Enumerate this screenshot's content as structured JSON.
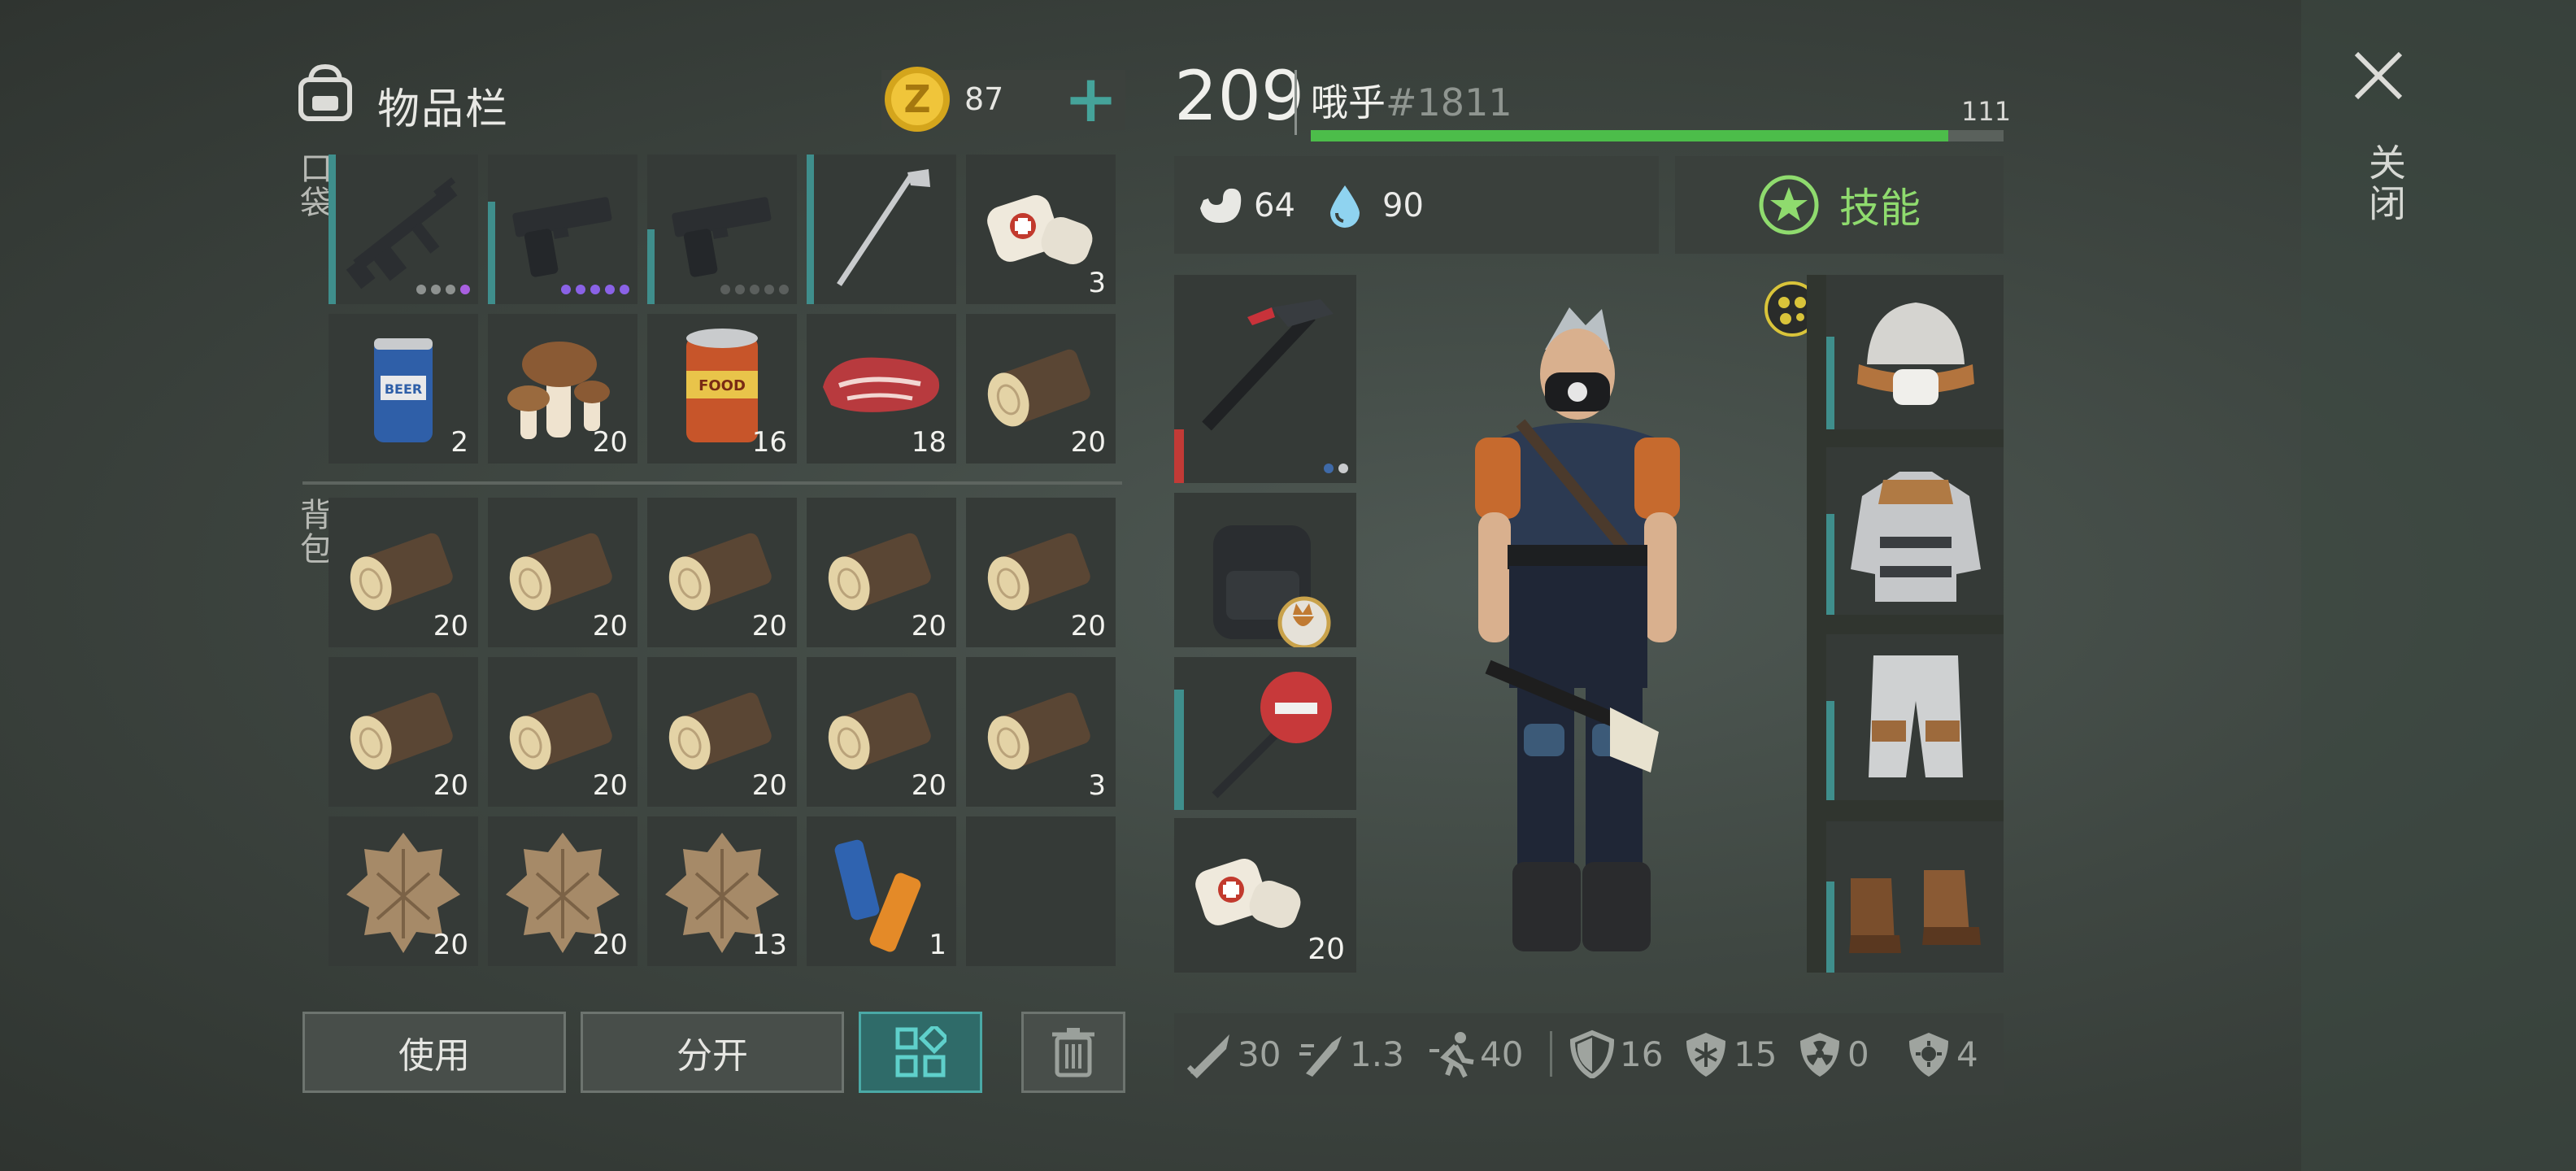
{
  "inventory": {
    "title": "物品栏",
    "coins": "87",
    "add_label": "+",
    "pocket_label": "口袋",
    "backpack_label": "背包",
    "pocket_slots": [
      {
        "item": "assault-rifle",
        "qty": ""
      },
      {
        "item": "pistol",
        "qty": ""
      },
      {
        "item": "pistol",
        "qty": ""
      },
      {
        "item": "golf-club",
        "qty": ""
      },
      {
        "item": "bandage",
        "qty": "3"
      },
      {
        "item": "beer-can",
        "qty": "2"
      },
      {
        "item": "mushrooms",
        "qty": "20"
      },
      {
        "item": "canned-food",
        "qty": "16"
      },
      {
        "item": "raw-steak",
        "qty": "18"
      },
      {
        "item": "wood-log",
        "qty": "20"
      }
    ],
    "backpack_slots": [
      {
        "item": "wood-log",
        "qty": "20"
      },
      {
        "item": "wood-log",
        "qty": "20"
      },
      {
        "item": "wood-log",
        "qty": "20"
      },
      {
        "item": "wood-log",
        "qty": "20"
      },
      {
        "item": "wood-log",
        "qty": "20"
      },
      {
        "item": "wood-log",
        "qty": "20"
      },
      {
        "item": "wood-log",
        "qty": "20"
      },
      {
        "item": "wood-log",
        "qty": "20"
      },
      {
        "item": "wood-log",
        "qty": "20"
      },
      {
        "item": "wood-log",
        "qty": "3"
      },
      {
        "item": "animal-fur",
        "qty": "20"
      },
      {
        "item": "animal-fur",
        "qty": "20"
      },
      {
        "item": "animal-fur",
        "qty": "13"
      },
      {
        "item": "batteries",
        "qty": "1"
      },
      {
        "item": "empty",
        "qty": ""
      }
    ],
    "buttons": {
      "use": "使用",
      "split": "分开"
    }
  },
  "player": {
    "level": "209",
    "name": "哦乎",
    "id": "#1811",
    "xp_value": "111",
    "xp_fill": 0.92,
    "hunger": "64",
    "thirst": "90",
    "skills_label": "技能"
  },
  "equipment": {
    "weapon_slots": [
      {
        "item": "hammer-weapon",
        "qty": ""
      },
      {
        "item": "backpack-with-cat-badge",
        "qty": ""
      },
      {
        "item": "stop-sign-weapon",
        "qty": ""
      },
      {
        "item": "bandage",
        "qty": "20"
      }
    ],
    "armor_slots": [
      "winter-hat",
      "armored-jacket",
      "armored-pants",
      "leather-boots"
    ]
  },
  "combat_stats": [
    {
      "icon": "damage-sword-icon",
      "value": "30"
    },
    {
      "icon": "attack-speed-icon",
      "value": "1.3"
    },
    {
      "icon": "movement-speed-icon",
      "value": "40"
    },
    {
      "icon": "armor-shield-icon",
      "value": "16"
    },
    {
      "icon": "cold-protection-icon",
      "value": "15"
    },
    {
      "icon": "radiation-protection-icon",
      "value": "0"
    },
    {
      "icon": "infection-protection-icon",
      "value": "4"
    }
  ],
  "close_label": "关闭",
  "colors": {
    "accent_teal": "#45a39a",
    "xp_green": "#4cbd4a",
    "skill_green": "#8fdb6e"
  }
}
